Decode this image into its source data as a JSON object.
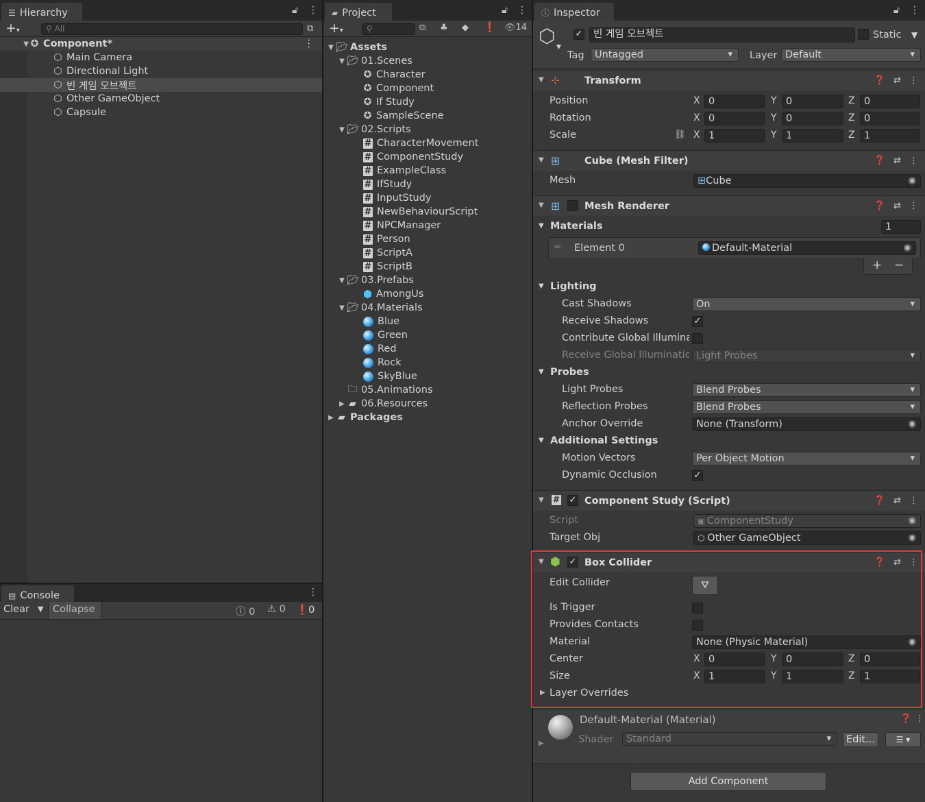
{
  "hierarchy": {
    "tab": "Hierarchy",
    "search_placeholder": "All",
    "scene": "Component*",
    "objects": [
      "Main Camera",
      "Directional Light",
      "빈 게임 오브젝트",
      "Other GameObject",
      "Capsule"
    ]
  },
  "project": {
    "tab": "Project",
    "hidden_count": "14",
    "assets_label": "Assets",
    "packages_label": "Packages",
    "folders": {
      "scenes": "01.Scenes",
      "scripts": "02.Scripts",
      "prefabs": "03.Prefabs",
      "materials": "04.Materials",
      "animations": "05.Animations",
      "resources": "06.Resources"
    },
    "scenes": [
      "Character",
      "Component",
      "If Study",
      "SampleScene"
    ],
    "scripts": [
      "CharacterMovement",
      "ComponentStudy",
      "ExampleClass",
      "IfStudy",
      "InputStudy",
      "NewBehaviourScript",
      "NPCManager",
      "Person",
      "ScriptA",
      "ScriptB"
    ],
    "prefabs": [
      "AmongUs"
    ],
    "materials": [
      "Blue",
      "Green",
      "Red",
      "Rock",
      "SkyBlue"
    ]
  },
  "console": {
    "tab": "Console",
    "clear": "Clear",
    "collapse": "Collapse",
    "count_log": "0",
    "count_warn": "0",
    "count_err": "0"
  },
  "inspector": {
    "tab": "Inspector",
    "object_name": "빈 게임 오브젝트",
    "static_label": "Static",
    "tag_label": "Tag",
    "tag_value": "Untagged",
    "layer_label": "Layer",
    "layer_value": "Default",
    "transform": {
      "title": "Transform",
      "position_label": "Position",
      "rotation_label": "Rotation",
      "scale_label": "Scale",
      "position": {
        "x": "0",
        "y": "0",
        "z": "0"
      },
      "rotation": {
        "x": "0",
        "y": "0",
        "z": "0"
      },
      "scale": {
        "x": "1",
        "y": "1",
        "z": "1"
      }
    },
    "axes": {
      "x": "X",
      "y": "Y",
      "z": "Z"
    },
    "mesh_filter": {
      "title": "Cube (Mesh Filter)",
      "mesh_label": "Mesh",
      "mesh_value": "Cube"
    },
    "mesh_renderer": {
      "title": "Mesh Renderer",
      "materials_label": "Materials",
      "materials_count": "1",
      "element0_label": "Element 0",
      "element0_value": "Default-Material",
      "plus": "+",
      "minus": "−",
      "lighting_label": "Lighting",
      "cast_shadows_label": "Cast Shadows",
      "cast_shadows_value": "On",
      "receive_shadows_label": "Receive Shadows",
      "contribute_gi_label": "Contribute Global Illuminat",
      "receive_gi_label": "Receive Global Illuminatio",
      "receive_gi_value": "Light Probes",
      "probes_label": "Probes",
      "light_probes_label": "Light Probes",
      "light_probes_value": "Blend Probes",
      "reflection_probes_label": "Reflection Probes",
      "reflection_probes_value": "Blend Probes",
      "anchor_override_label": "Anchor Override",
      "anchor_override_value": "None (Transform)",
      "additional_label": "Additional Settings",
      "motion_vectors_label": "Motion Vectors",
      "motion_vectors_value": "Per Object Motion",
      "dynamic_occlusion_label": "Dynamic Occlusion"
    },
    "component_study": {
      "title": "Component Study (Script)",
      "script_label": "Script",
      "script_value": "ComponentStudy",
      "target_label": "Target Obj",
      "target_value": "Other GameObject"
    },
    "box_collider": {
      "title": "Box Collider",
      "edit_label": "Edit Collider",
      "trigger_label": "Is Trigger",
      "contacts_label": "Provides Contacts",
      "material_label": "Material",
      "material_value": "None (Physic Material)",
      "center_label": "Center",
      "center": {
        "x": "0",
        "y": "0",
        "z": "0"
      },
      "size_label": "Size",
      "size": {
        "x": "1",
        "y": "1",
        "z": "1"
      },
      "overrides_label": "Layer Overrides"
    },
    "material": {
      "title": "Default-Material (Material)",
      "shader_label": "Shader",
      "shader_value": "Standard",
      "edit_button": "Edit..."
    },
    "add_component": "Add Component"
  },
  "colors": {
    "highlight_box": "#e53935",
    "panel_bg": "#383838"
  }
}
